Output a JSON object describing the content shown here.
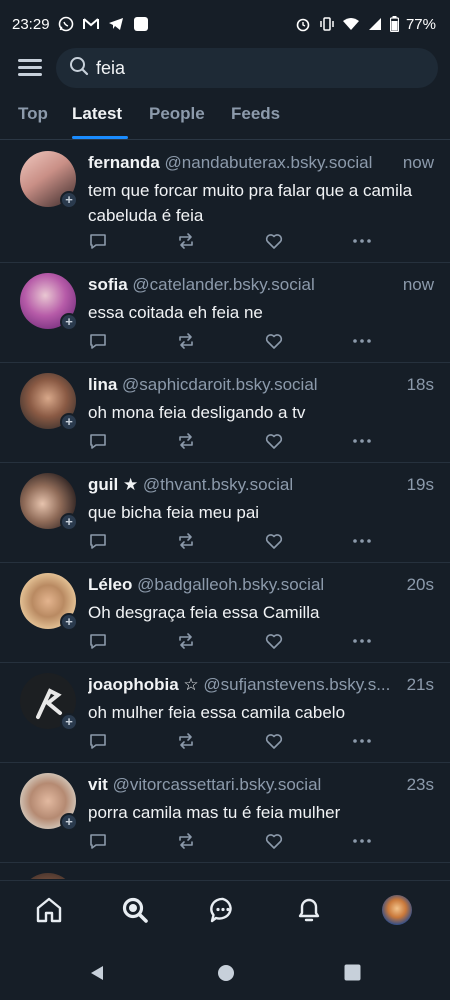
{
  "status_bar": {
    "time": "23:29",
    "battery": "77%",
    "left_icons": [
      "whatsapp-icon",
      "gmail-icon",
      "telegram-icon",
      "app-square-icon"
    ],
    "right_icons": [
      "alarm-icon",
      "vibrate-icon",
      "wifi-icon",
      "signal-icon",
      "battery-icon"
    ]
  },
  "search": {
    "query": "feia"
  },
  "tabs": [
    {
      "label": "Top",
      "active": false
    },
    {
      "label": "Latest",
      "active": true
    },
    {
      "label": "People",
      "active": false
    },
    {
      "label": "Feeds",
      "active": false
    }
  ],
  "posts": [
    {
      "name": "fernanda",
      "handle": "@nandabuterax.bsky.social",
      "time": "now",
      "text": "tem que forcar muito pra falar que a camila cabeluda é feia"
    },
    {
      "name": "sofia",
      "handle": "@catelander.bsky.social",
      "time": "now",
      "text": "essa coitada eh feia ne"
    },
    {
      "name": "lina",
      "handle": "@saphicdaroit.bsky.social",
      "time": "18s",
      "text": "oh mona feia desligando a tv"
    },
    {
      "name": "guil ★",
      "handle": "@thvant.bsky.social",
      "time": "19s",
      "text": "que bicha feia meu pai"
    },
    {
      "name": "Léleo",
      "handle": "@badgalleoh.bsky.social",
      "time": "20s",
      "text": "Oh desgraça feia essa Camilla"
    },
    {
      "name": "joaophobia ☆",
      "handle": "@sufjanstevens.bsky.s...",
      "time": "21s",
      "text": "oh mulher feia essa camila cabelo"
    },
    {
      "name": "vit",
      "handle": "@vitorcassettari.bsky.social",
      "time": "23s",
      "text": "porra camila mas tu é feia mulher"
    }
  ],
  "colors": {
    "background": "#161e27",
    "accent": "#1a8cff",
    "muted_text": "#8c9aab",
    "search_bg": "#1e2a36"
  },
  "nav": {
    "items": [
      "home-icon",
      "search-icon",
      "chat-icon",
      "notifications-icon",
      "profile-avatar"
    ]
  }
}
